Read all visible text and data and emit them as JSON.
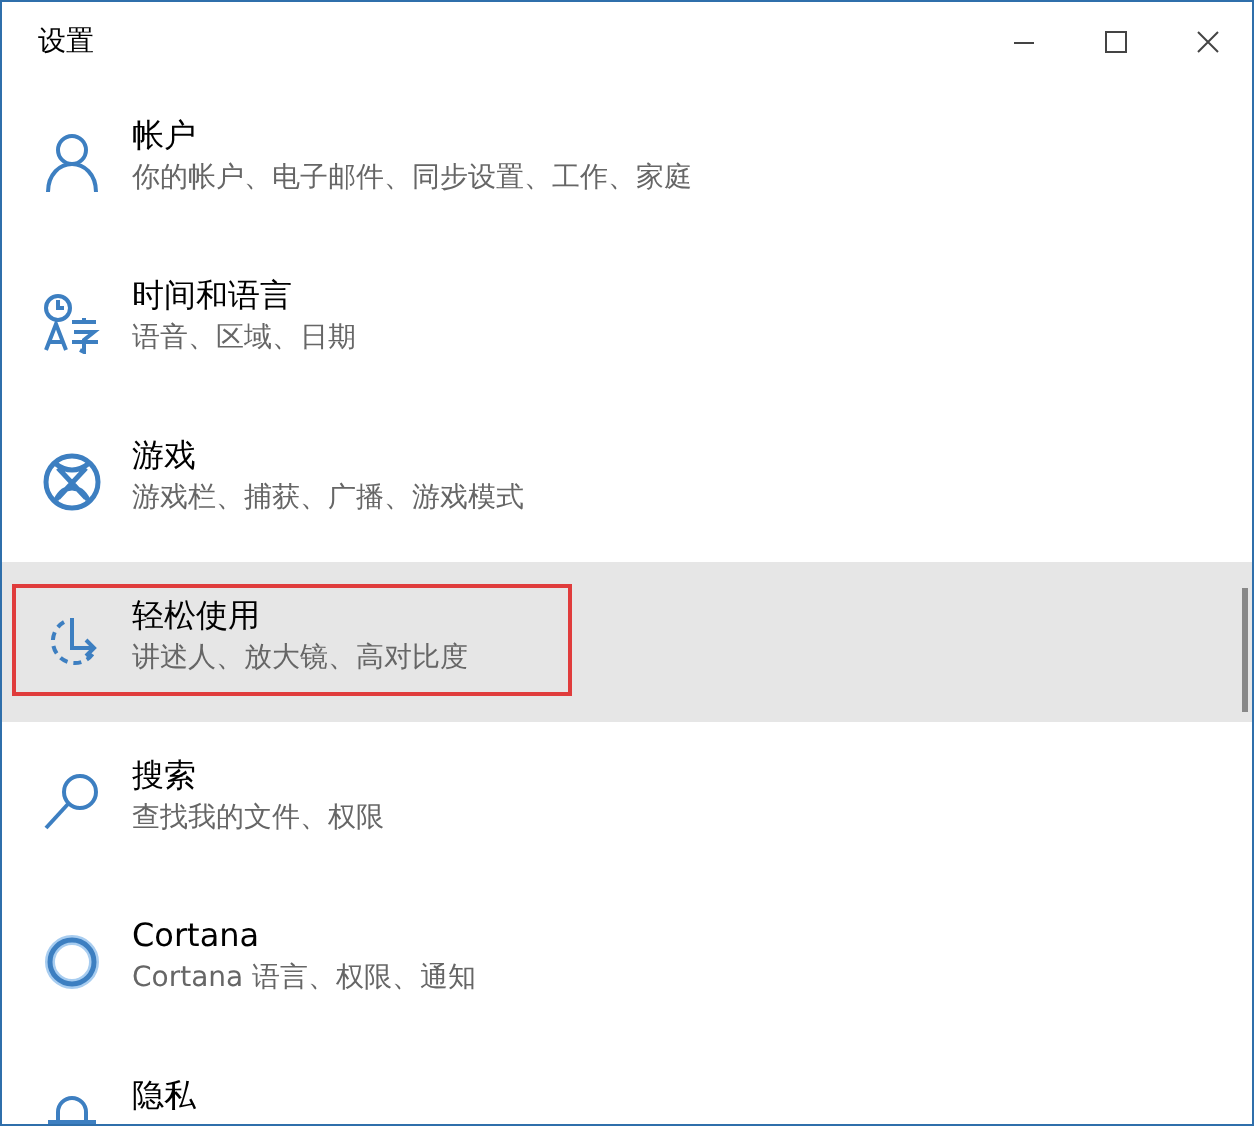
{
  "window": {
    "title": "设置"
  },
  "items": [
    {
      "title": "帐户",
      "subtitle": "你的帐户、电子邮件、同步设置、工作、家庭",
      "selected": false,
      "outlined": false
    },
    {
      "title": "时间和语言",
      "subtitle": "语音、区域、日期",
      "selected": false,
      "outlined": false
    },
    {
      "title": "游戏",
      "subtitle": "游戏栏、捕获、广播、游戏模式",
      "selected": false,
      "outlined": false
    },
    {
      "title": "轻松使用",
      "subtitle": "讲述人、放大镜、高对比度",
      "selected": true,
      "outlined": true
    },
    {
      "title": "搜索",
      "subtitle": "查找我的文件、权限",
      "selected": false,
      "outlined": false
    },
    {
      "title": "Cortana",
      "subtitle": "Cortana 语言、权限、通知",
      "selected": false,
      "outlined": false
    },
    {
      "title": "隐私",
      "selected": false,
      "outlined": false
    }
  ]
}
